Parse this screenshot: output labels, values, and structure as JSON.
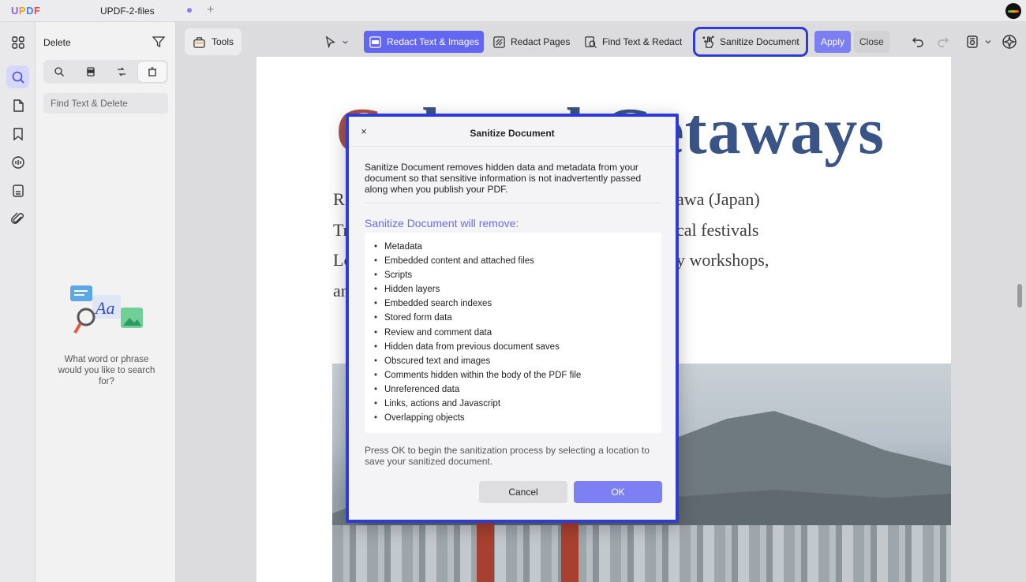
{
  "app": {
    "logo": "UPDF",
    "tab_title": "UPDF-2-files"
  },
  "left_panel": {
    "title": "Delete",
    "search_placeholder": "Find Text & Delete",
    "empty_message": "What word or phrase would you like to search for?"
  },
  "tools_button": {
    "label": "Tools"
  },
  "toolbar": {
    "redact_text_images": "Redact Text & Images",
    "redact_pages": "Redact Pages",
    "find_text_redact": "Find Text & Redact",
    "sanitize_document": "Sanitize Document",
    "apply": "Apply",
    "close": "Close"
  },
  "document": {
    "title_first": "C",
    "title_rest": "ultural Getaways",
    "lines": [
      "R",
      "awa (Japan)",
      "Tr",
      "cal festivals",
      "Lo",
      "y workshops,",
      "an"
    ]
  },
  "dialog": {
    "title": "Sanitize Document",
    "close_symbol": "×",
    "description": "Sanitize Document removes hidden data and metadata from your document so that sensitive information is not inadvertently passed along when you publish your PDF.",
    "subtitle": "Sanitize Document will remove:",
    "items": [
      "Metadata",
      "Embedded content and attached files",
      "Scripts",
      "Hidden layers",
      "Embedded search indexes",
      "Stored form data",
      "Review and comment data",
      "Hidden data from previous document saves",
      "Obscured text and images",
      "Comments hidden within the body of the PDF file",
      "Unreferenced data",
      "Links, actions and Javascript",
      "Overlapping objects"
    ],
    "note": "Press OK to begin the sanitization process by selecting a location to save your sanitized document.",
    "cancel_label": "Cancel",
    "ok_label": "OK"
  },
  "colors": {
    "accent": "#6366f1",
    "highlight_border": "#2f3bd6",
    "subtitle": "#6b6de6"
  }
}
